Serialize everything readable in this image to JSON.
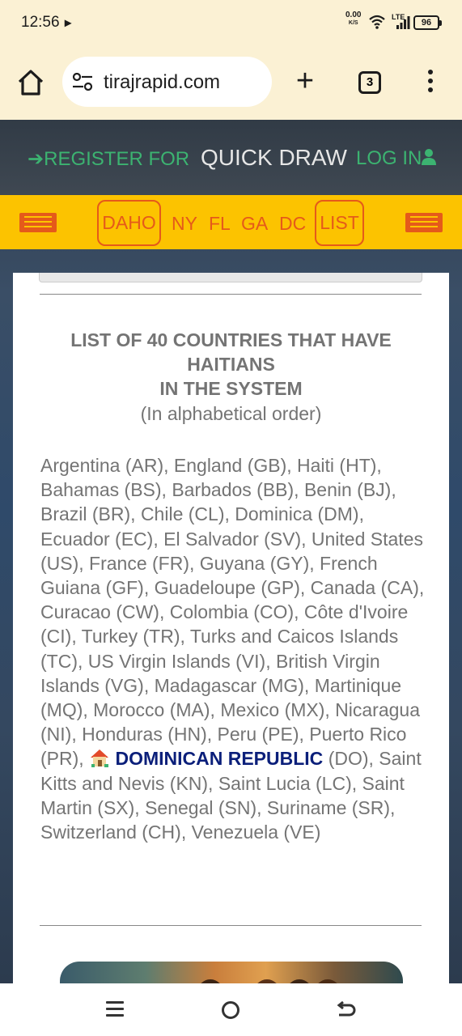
{
  "status_bar": {
    "time": "12:56",
    "net_speed": "0.00",
    "net_unit": "K/S",
    "network": "LTE",
    "battery": "96"
  },
  "browser": {
    "url": "tirajrapid.com",
    "tab_count": "3"
  },
  "site": {
    "nav": {
      "register": "REGISTER FOR",
      "center_title": "QUICK DRAW",
      "login": "LOG IN"
    },
    "states": {
      "daho": "DAHO",
      "ny": "NY",
      "fl": "FL",
      "ga": "GA",
      "dc": "DC",
      "list": "LIST"
    },
    "content": {
      "heading_line1": "LIST OF 40 COUNTRIES THAT HAVE",
      "heading_line2": "HAITIANS",
      "heading_line3": "IN THE SYSTEM",
      "subheading": "(In alphabetical order)",
      "countries_before": "Argentina (AR), England (GB), Haiti (HT), Bahamas (BS), Barbados (BB), Benin (BJ), Brazil (BR), Chile (CL), Dominica (DM), Ecuador (EC), El Salvador (SV), United States (US), France (FR), Guyana (GY), French Guiana (GF), Guadeloupe (GP), Canada (CA), Curacao (CW), Colombia (CO), Côte d'Ivoire (CI), Turkey (TR), Turks and Caicos Islands (TC), US Virgin Islands (VI), British Virgin Islands (VG), Madagascar (MG), Martinique (MQ), Morocco (MA), Mexico (MX), Nicaragua (NI), Honduras (HN), Peru (PE), Puerto Rico (PR),",
      "highlight": "DOMINICAN REPUBLIC",
      "countries_after": "(DO), Saint Kitts and Nevis (KN), Saint Lucia (LC), Saint Martin (SX), Senegal (SN), Suriname (SR), Switzerland (CH), Venezuela (VE)"
    }
  },
  "colors": {
    "chrome_bg": "#fbf1d4",
    "accent_green": "#3cb371",
    "yellow_bar": "#fcc300",
    "orange": "#e55a1a",
    "highlight_blue": "#0b1f7a",
    "text_gray": "#747474"
  },
  "icons": {
    "home": "home-icon",
    "site_info": "tune-icon",
    "new_tab": "plus-icon",
    "menu": "more-vert-icon",
    "register": "sign-in-icon",
    "login": "user-icon",
    "house": "house-icon"
  }
}
